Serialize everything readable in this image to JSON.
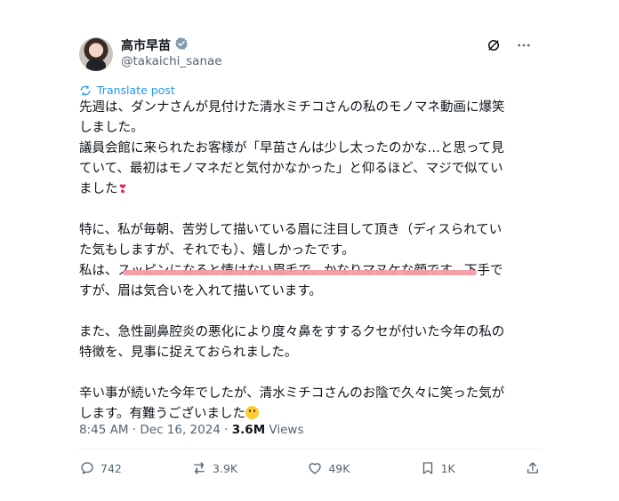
{
  "post": {
    "author": {
      "display_name": "高市早苗",
      "handle": "@takaichi_sanae"
    },
    "translate_label": "Translate post",
    "text_lines": [
      "先週は、ダンナさんが見付けた清水ミチコさんの私のモノマネ動画に爆笑",
      "しました。",
      "議員会館に来られたお客様が「早苗さんは少し太ったのかな…と思って見",
      "ていて、最初はモノマネだと気付かなかった」と仰るほど、マジで似てい",
      "ました",
      "",
      "特に、私が毎朝、苦労して描いている眉に注目して頂き（ディスられてい",
      "た気もしますが、それでも）、嬉しかったです。",
      "私は、スッピンになると情けない眉毛で、かなりマヌケな顔です。下手で",
      "すが、眉は気合いを入れて描いています。",
      "",
      "また、急性副鼻腔炎の悪化により度々鼻をすするクセが付いた今年の私の",
      "特徴を、見事に捉えておられました。",
      "",
      "辛い事が続いた今年でしたが、清水ミチコさんのお陰で久々に笑った気が",
      "します。有難うございました"
    ],
    "meta": {
      "time": "8:45 AM · Dec 16, 2024 · ",
      "views_count": "3.6M",
      "views_label": " Views"
    },
    "actions": {
      "replies": "742",
      "reposts": "3.9K",
      "likes": "49K",
      "bookmarks": "1K"
    }
  },
  "icons": {
    "verified": "verified-badge-icon",
    "grok": "grok-icon",
    "more": "more-icon",
    "translate": "translate-icon",
    "reply": "reply-icon",
    "repost": "repost-icon",
    "like": "like-icon",
    "bookmark": "bookmark-icon",
    "share": "share-icon"
  },
  "colors": {
    "accent": "#1d9bf0",
    "muted": "#536471",
    "text": "#0f1419",
    "highlight": "#f29da4",
    "heart": "#e0245e"
  }
}
